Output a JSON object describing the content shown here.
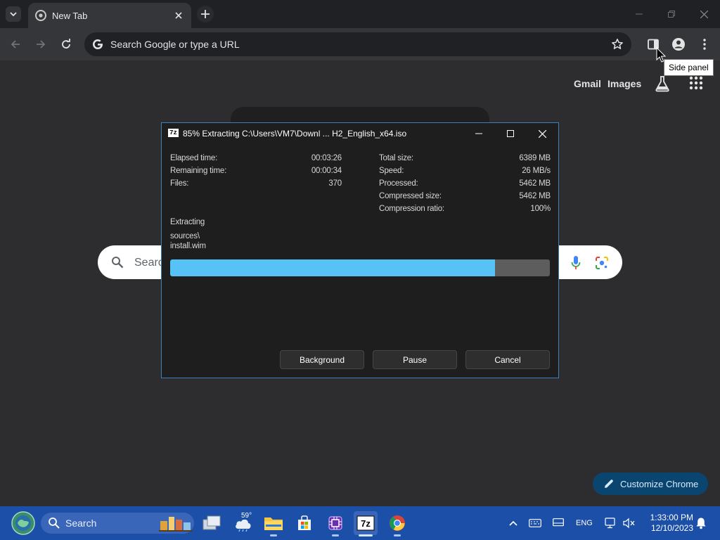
{
  "browser": {
    "tab": {
      "title": "New Tab"
    },
    "omnibox": {
      "placeholder": "Search Google or type a URL"
    },
    "tooltip": "Side panel"
  },
  "ntp": {
    "links": {
      "gmail": "Gmail",
      "images": "Images"
    },
    "search_placeholder": "Search",
    "customize_label": "Customize Chrome"
  },
  "dialog": {
    "logo": "7z",
    "title": "85% Extracting C:\\Users\\VM7\\Downl ... H2_English_x64.iso",
    "left_stats": [
      {
        "label": "Elapsed time:",
        "value": "00:03:26"
      },
      {
        "label": "Remaining time:",
        "value": "00:00:34"
      },
      {
        "label": "Files:",
        "value": "370"
      }
    ],
    "right_stats": [
      {
        "label": "Total size:",
        "value": "6389 MB"
      },
      {
        "label": "Speed:",
        "value": "26 MB/s"
      },
      {
        "label": "Processed:",
        "value": "5462 MB"
      },
      {
        "label": "Compressed size:",
        "value": "5462 MB"
      },
      {
        "label": "Compression ratio:",
        "value": "100%"
      }
    ],
    "action_label": "Extracting",
    "current_path": "sources\\",
    "current_file": "install.wim",
    "progress": 0.855,
    "buttons": {
      "background": "Background",
      "pause": "Pause",
      "cancel": "Cancel"
    },
    "accent_color": "#56c2f5"
  },
  "taskbar": {
    "search_label": "Search",
    "weather_temp": "59°",
    "seven_zip_label": "7z",
    "language": "ENG",
    "time": "1:33:00 PM",
    "date": "12/10/2023"
  }
}
